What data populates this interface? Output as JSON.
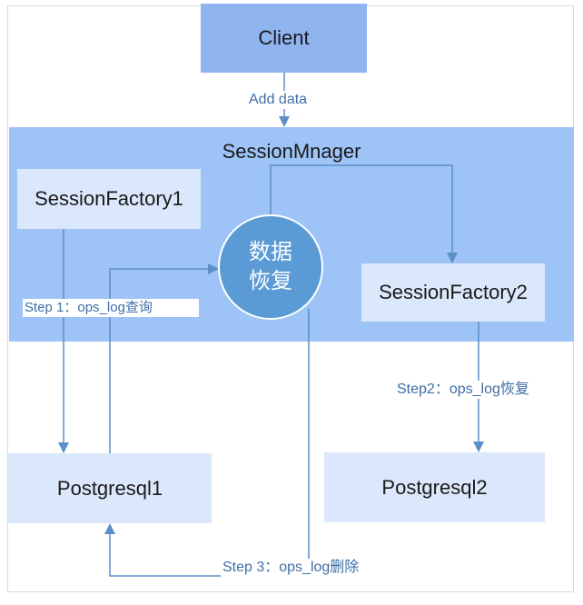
{
  "nodes": {
    "client": "Client",
    "session_manager": "SessionMnager",
    "session_factory_1": "SessionFactory1",
    "session_factory_2": "SessionFactory2",
    "recovery": "数据恢复",
    "postgresql_1": "Postgresql1",
    "postgresql_2": "Postgresql2"
  },
  "edges": {
    "add_data": "Add data",
    "step1": "Step 1：ops_log查询",
    "step2": "Step2：ops_log恢复",
    "step3": "Step 3：ops_log删除"
  },
  "colors": {
    "band": "#9dc3f7",
    "client_box": "#8fb4f0",
    "factory_box": "#dbe7fa",
    "db_box": "#dbe7fa",
    "circle": "#5b9bd5",
    "line": "#5b8fc7",
    "label_text": "#3f6fa6"
  }
}
